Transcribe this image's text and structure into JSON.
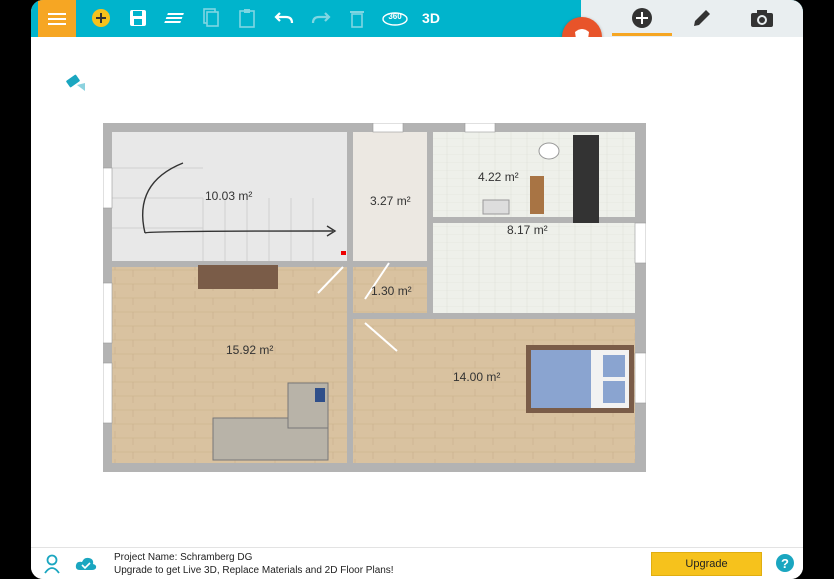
{
  "toolbar": {
    "icons": [
      "menu-icon",
      "add-icon",
      "save-icon",
      "layers-icon",
      "copy-icon",
      "paste-icon",
      "undo-icon",
      "redo-icon",
      "delete-icon",
      "view-360-icon"
    ],
    "label_360": "360",
    "label_3d": "3D",
    "accent": "#00b4cc",
    "menu_color": "#f6a623"
  },
  "right_panel": {
    "icons": [
      "add-circle-icon",
      "pencil-icon",
      "camera-icon"
    ]
  },
  "rooms": [
    {
      "area": "10.03 m²"
    },
    {
      "area": "3.27 m²"
    },
    {
      "area": "4.22 m²"
    },
    {
      "area": "8.17 m²"
    },
    {
      "area": "1.30 m²"
    },
    {
      "area": "15.92 m²"
    },
    {
      "area": "14.00 m²"
    }
  ],
  "footer": {
    "project_name": "Project Name: Schramberg DG",
    "upgrade_message": "Upgrade to get Live 3D, Replace Materials and 2D Floor Plans!",
    "upgrade_button": "Upgrade",
    "help_label": "?"
  },
  "collapse_label": "«"
}
